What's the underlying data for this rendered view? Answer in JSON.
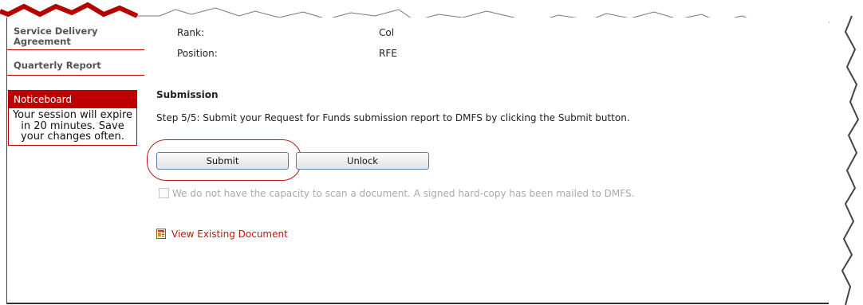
{
  "sidebar": {
    "items": [
      {
        "label": "Service Delivery Agreement"
      },
      {
        "label": "Quarterly Report"
      }
    ],
    "noticeboard": {
      "title": "Noticeboard",
      "message": "Your session will expire in 20 minutes. Save your changes often."
    }
  },
  "details": {
    "rows": [
      {
        "label": "Rank:",
        "value": "Col"
      },
      {
        "label": "Position:",
        "value": "RFE"
      }
    ]
  },
  "submission": {
    "title": "Submission",
    "step_text": "Step 5/5: Submit your Request for Funds submission report to DMFS by clicking the Submit button.",
    "submit_label": "Submit",
    "unlock_label": "Unlock",
    "checkbox_label": "We do not have the capacity to scan a document. A signed hard-copy has been mailed to DMFS.",
    "checkbox_checked": false,
    "document_link": "View Existing Document"
  },
  "colors": {
    "accent": "#c00000",
    "link": "#cc1111",
    "annotation_ring": "#c0161a"
  }
}
